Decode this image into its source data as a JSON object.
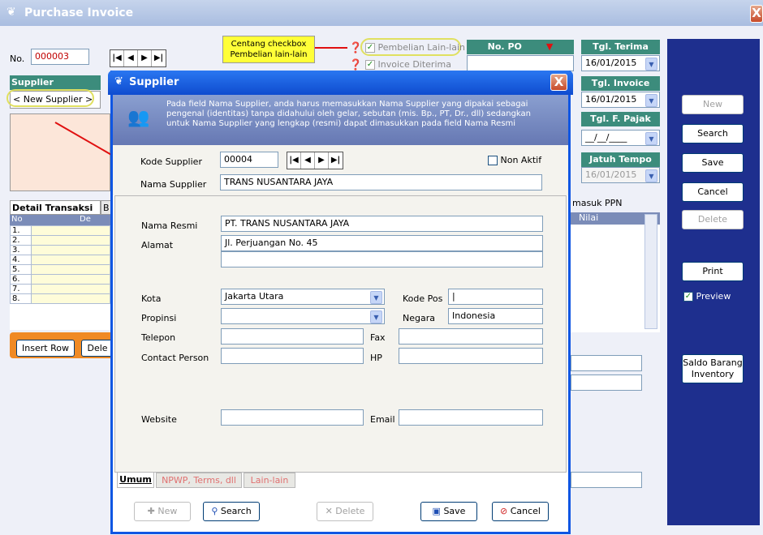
{
  "window": {
    "title": "Purchase Invoice",
    "close": "X"
  },
  "form": {
    "no_label": "No.",
    "no_value": "000003",
    "supplier_label": "Supplier",
    "supplier_value": "< New Supplier >",
    "callout": "Centang checkbox Pembelian lain-lain",
    "cb1": "Pembelian Lain-lain",
    "cb2": "Invoice Diterima",
    "po_label": "No. PO",
    "tgl_terima_label": "Tgl. Terima",
    "tgl_terima": "16/01/2015",
    "tgl_invoice_label": "Tgl. Invoice",
    "tgl_invoice": "16/01/2015",
    "tgl_pajak_label": "Tgl. F. Pajak",
    "tgl_pajak": "__/__/____",
    "jatuh_tempo_label": "Jatuh Tempo",
    "jatuh_tempo": "16/01/2015",
    "masuk_ppn": "masuk PPN",
    "nilai": "Nilai",
    "tab_detail": "Detail Transaksi",
    "tab_b": "B",
    "col_no": "No",
    "col_d": "De",
    "rows": [
      "1.",
      "2.",
      "3.",
      "4.",
      "5.",
      "6.",
      "7.",
      "8."
    ],
    "insert_row": "Insert Row",
    "dele": "Dele"
  },
  "right": {
    "new": "New",
    "search": "Search",
    "save": "Save",
    "cancel": "Cancel",
    "delete": "Delete",
    "print": "Print",
    "preview": "Preview",
    "saldo": "Saldo Barang Inventory"
  },
  "dialog": {
    "title": "Supplier",
    "close": "X",
    "info": "Pada field Nama Supplier, anda harus memasukkan Nama Supplier yang dipakai sebagai pengenal (identitas) tanpa didahului oleh gelar, sebutan (mis. Bp., PT, Dr., dll) sedangkan untuk Nama Supplier yang lengkap (resmi) dapat dimasukkan pada field Nama Resmi",
    "kode_label": "Kode Supplier",
    "kode": "00004",
    "non_aktif": "Non Aktif",
    "nama_label": "Nama Supplier",
    "nama": "TRANS NUSANTARA JAYA",
    "resmi_label": "Nama Resmi",
    "resmi": "PT. TRANS NUSANTARA JAYA",
    "alamat_label": "Alamat",
    "alamat": "Jl. Perjuangan No. 45",
    "kota_label": "Kota",
    "kota": "Jakarta Utara",
    "kodepos_label": "Kode Pos",
    "propinsi_label": "Propinsi",
    "negara_label": "Negara",
    "negara": "Indonesia",
    "telepon_label": "Telepon",
    "fax_label": "Fax",
    "cp_label": "Contact Person",
    "hp_label": "HP",
    "website_label": "Website",
    "email_label": "Email",
    "tab1": "Umum",
    "tab2": "NPWP, Terms, dll",
    "tab3": "Lain-lain",
    "btn_new": "New",
    "btn_search": "Search",
    "btn_delete": "Delete",
    "btn_save": "Save",
    "btn_cancel": "Cancel"
  }
}
